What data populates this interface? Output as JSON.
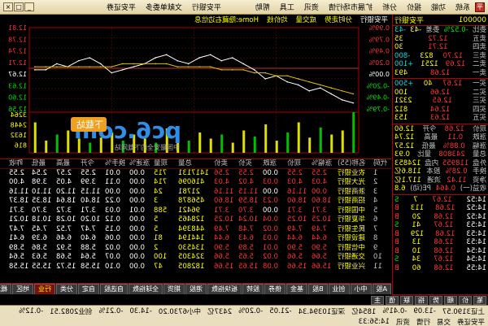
{
  "titlebar": {
    "app_icon": "app-logo-icon",
    "menus": [
      "系统",
      "功能",
      "报价",
      "分析",
      "扩展市场行情",
      "资讯",
      "工具",
      "帮助"
    ],
    "broker_links": [
      "平安银行",
      "文献单委多",
      "平安证券"
    ],
    "window_buttons": [
      "_",
      "□",
      "×"
    ]
  },
  "left_panel": {
    "stock_code": "000001",
    "stock_name": "平安银行",
    "rows_top": [
      {
        "k": "委比",
        "v": "-0.52%",
        "k2": "委差",
        "v2": "-43",
        "c": "green"
      },
      {
        "k": "卖五",
        "v": "12.72",
        "v2": "35",
        "c": "red"
      },
      {
        "k": "卖四",
        "v": "12.71",
        "v2": "30",
        "c": "red"
      },
      {
        "k": "卖三",
        "v": "12.70",
        "v2": "823",
        "c": "red"
      },
      {
        "k": "卖二",
        "v": "12.69",
        "v2": "1251",
        "c": "red"
      },
      {
        "k": "卖一",
        "v": "12.68",
        "v2": "493",
        "c": "red"
      }
    ],
    "rows_bid": [
      {
        "k": "买一",
        "v": "12.67",
        "v2": "40",
        "c": "red"
      },
      {
        "k": "买二",
        "v": "12.66",
        "v2": "100",
        "c": "red"
      },
      {
        "k": "买三",
        "v": "12.65",
        "v2": "2321",
        "c": "red"
      },
      {
        "k": "买四",
        "v": "12.64",
        "v2": "812",
        "c": "red"
      },
      {
        "k": "买五",
        "v": "12.63",
        "v2": "153",
        "c": "red"
      }
    ],
    "side_changes": [
      "-43",
      "",
      "",
      "-800",
      "+100",
      "",
      "+500"
    ],
    "rows_stats": [
      {
        "k": "现价",
        "v": "12.68",
        "k2": "今开",
        "v2": "12.60"
      },
      {
        "k": "涨跌",
        "v": "0.11",
        "k2": "最高",
        "v2": "12.74"
      },
      {
        "k": "涨幅",
        "v": "0.88%",
        "k2": "最低",
        "v2": "12.57"
      },
      {
        "k": "总量",
        "v": "243808",
        "k2": "量比",
        "v2": "0.93"
      },
      {
        "k": "外盘",
        "v": "118955",
        "k2": "内盘",
        "v2": "124853"
      },
      {
        "k": "换手",
        "v": "0.28%",
        "k2": "股本",
        "v2": "118.6亿"
      },
      {
        "k": "净资",
        "v": "11.42",
        "k2": "流通",
        "v2": "117.1亿"
      },
      {
        "k": "收益(一)",
        "v": "0.464",
        "k2": "PE(动)",
        "v2": "6.8"
      }
    ],
    "ticks": [
      {
        "t": "14:52",
        "p": "12.67",
        "v": "7",
        "d": "S"
      },
      {
        "t": "14:52",
        "p": "12.68",
        "v": "113",
        "d": "B"
      },
      {
        "t": "14:52",
        "p": "12.68",
        "v": "20",
        "d": "B"
      },
      {
        "t": "14:53",
        "p": "12.67",
        "v": "41",
        "d": "S"
      },
      {
        "t": "14:53",
        "p": "12.68",
        "v": "129",
        "d": "B"
      },
      {
        "t": "14:53",
        "p": "12.68",
        "v": "13",
        "d": "B"
      },
      {
        "t": "14:54",
        "p": "12.68",
        "v": "10",
        "d": "B"
      },
      {
        "t": "14:54",
        "p": "12.67",
        "v": "34",
        "d": "S"
      },
      {
        "t": "14:55",
        "p": "12.68",
        "v": "60",
        "d": "B"
      }
    ],
    "bottom_tabs": [
      "笔",
      "价",
      "细",
      "势",
      "指",
      "联",
      "值",
      "主"
    ]
  },
  "chart": {
    "header": [
      "平安银行",
      "分时走势",
      "成交量",
      "均价线",
      "Home:隐藏右边信息"
    ],
    "right_prices": [
      "12.81",
      "12.78",
      "12.74",
      "12.71",
      "12.67",
      "12.63",
      "12.60",
      "12.56"
    ],
    "right_pcts": [
      "0.99%",
      "0.79%",
      "0.49%",
      "0.20%",
      "0.00%",
      "-0.20%",
      "-0.49%",
      "-0.79%"
    ],
    "vol_labels": [
      "3264",
      "2448",
      "1632",
      "816"
    ],
    "watermark_text": "pc6.com",
    "watermark_sub": "下载站",
    "watermark_tagline": "中国最安全的下载网站"
  },
  "chart_data": {
    "type": "line",
    "series": [
      {
        "values": [
          12.57,
          12.58,
          12.6,
          12.62,
          12.61,
          12.63,
          12.64,
          12.66,
          12.65,
          12.68,
          12.7,
          12.72,
          12.71,
          12.73,
          12.72,
          12.7,
          12.71,
          12.73,
          12.72,
          12.7,
          12.69,
          12.68,
          12.67,
          12.7,
          12.72,
          12.71,
          12.69,
          12.7,
          12.68,
          12.68
        ]
      },
      {
        "values": [
          12.6,
          12.61,
          12.62,
          12.63,
          12.64,
          12.65,
          12.66,
          12.66,
          12.67,
          12.67,
          12.68,
          12.68,
          12.68,
          12.69,
          12.69,
          12.69,
          12.69,
          12.7,
          12.7,
          12.7,
          12.7,
          12.7,
          12.69,
          12.69,
          12.69,
          12.69,
          12.69,
          12.69,
          12.69,
          12.69
        ]
      }
    ],
    "volume": [
      40,
      22,
      18,
      25,
      15,
      30,
      20,
      12,
      28,
      16,
      22,
      10,
      18,
      14,
      20,
      12,
      16,
      24,
      10,
      14,
      18,
      12,
      20,
      15,
      10,
      14,
      22,
      18,
      12,
      30
    ],
    "ylim": [
      12.55,
      12.82
    ]
  },
  "table": {
    "headers": [
      "代码",
      "名称(55)",
      "涨幅%",
      "现价",
      "涨跌",
      "买价",
      "卖价",
      "总量",
      "现量",
      "涨速%",
      "换手%",
      "今开",
      "最高",
      "最低",
      "昨收"
    ],
    "rows": [
      [
        "1",
        "农业银行",
        "2.55",
        "2.55",
        "0.00",
        "2.55",
        "2.56",
        "1417131",
        "715",
        "0.00",
        "0.01",
        "2.55",
        "2.57",
        "2.54",
        "2.55"
      ],
      [
        "2",
        "光大银行",
        "4.03",
        "4.03",
        "0.03",
        "4.02",
        "4.03",
        "416096",
        "714",
        "0.00",
        "0.11",
        "3.99",
        "4.05",
        "3.98",
        "4.00"
      ],
      [
        "3",
        "浙商银行",
        "0.00",
        "11.16",
        "0.00",
        "11.15",
        "11.16",
        "21781",
        "24",
        "0.00",
        "0.00",
        "11.15",
        "11.20",
        "11.10",
        "11.16"
      ],
      [
        "4",
        "招商银行",
        "18.60",
        "18.60",
        "0.23",
        "18.59",
        "18.60",
        "456878",
        "3",
        "0.00",
        "0.22",
        "18.40",
        "18.64",
        "18.35",
        "18.37"
      ],
      [
        "5",
        "中国银行",
        "3.71",
        "3.71",
        "0.00",
        "3.70",
        "3.71",
        "96421",
        "588",
        "0.01",
        "0.03",
        "3.71",
        "3.72",
        "3.70",
        "3.71"
      ],
      [
        "6",
        "华夏银行",
        "10.25",
        "10.25",
        "0.04",
        "10.24",
        "10.25",
        "128465",
        "5",
        "0.00",
        "0.12",
        "10.20",
        "10.28",
        "10.18",
        "10.21"
      ],
      [
        "7",
        "民生银行",
        "7.49",
        "7.49",
        "0.02",
        "7.48",
        "7.49",
        "448394",
        "5",
        "0.00",
        "0.15",
        "7.47",
        "7.52",
        "7.45",
        "7.47"
      ],
      [
        "8",
        "建设银行",
        "6.44",
        "6.44",
        "0.03",
        "6.43",
        "6.44",
        "144194",
        "81",
        "0.00",
        "0.06",
        "6.40",
        "6.46",
        "6.39",
        "6.41"
      ],
      [
        "9",
        "中信银行",
        "5.90",
        "5.90",
        "0.01",
        "5.89",
        "5.90",
        "134530",
        "2",
        "0.00",
        "0.02",
        "5.88",
        "5.92",
        "5.86",
        "5.89"
      ],
      [
        "10",
        "交通银行",
        "5.66",
        "5.66",
        "0.02",
        "5.65",
        "5.66",
        "324305",
        "100",
        "0.00",
        "0.07",
        "5.64",
        "5.68",
        "5.63",
        "5.64"
      ],
      [
        "11",
        "兴业银行",
        "15.66",
        "15.66",
        "0.08",
        "15.65",
        "15.66",
        "182805",
        "47",
        "0.00",
        "0.10",
        "15.58",
        "15.72",
        "15.55",
        "15.58"
      ]
    ]
  },
  "tabs": [
    "A股",
    "中小",
    "创业",
    "B股",
    "基金",
    "债券",
    "股转",
    "板块指数",
    "港股",
    "期货",
    "全球指数",
    "自选股",
    "自定",
    "分类",
    "行业",
    "地区",
    "概念",
    "风格",
    "指数成份",
    "大盘",
    "主力",
    "资金"
  ],
  "active_tab": "行业",
  "statusbar": {
    "line1": [
      "上证3190.57",
      "-13.09",
      "-0.41%",
      "1854亿",
      "深证10394.34",
      "-21.05",
      "-0.20%",
      "2437亿",
      "中小6730.20",
      "-14.30",
      "-0.21%",
      "创业2082.51",
      "-0.12%"
    ],
    "line2": [
      "平安证券",
      "交易",
      "行情",
      "资讯",
      "14:56:33"
    ]
  }
}
